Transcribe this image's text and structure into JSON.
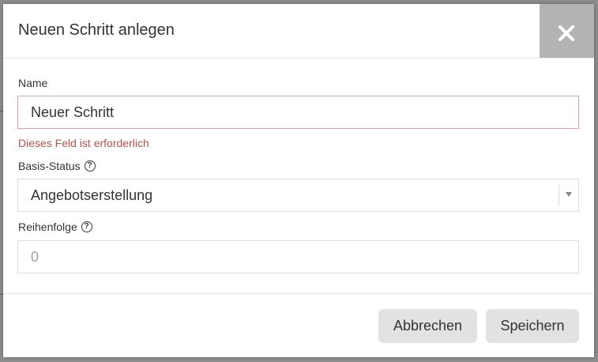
{
  "dialog": {
    "title": "Neuen Schritt anlegen",
    "close_icon": "close-icon"
  },
  "form": {
    "name": {
      "label": "Name",
      "value": "Neuer Schritt",
      "error": "Dieses Feld ist erforderlich"
    },
    "base_status": {
      "label": "Basis-Status",
      "help_icon": "question-circle-icon",
      "selected": "Angebotserstellung"
    },
    "order": {
      "label": "Reihenfolge",
      "help_icon": "question-circle-icon",
      "placeholder": "0"
    }
  },
  "footer": {
    "cancel_label": "Abbrechen",
    "save_label": "Speichern"
  },
  "colors": {
    "error": "#c0504d",
    "close_bg": "#b3b3b3",
    "button_bg": "#e2e2e2"
  }
}
